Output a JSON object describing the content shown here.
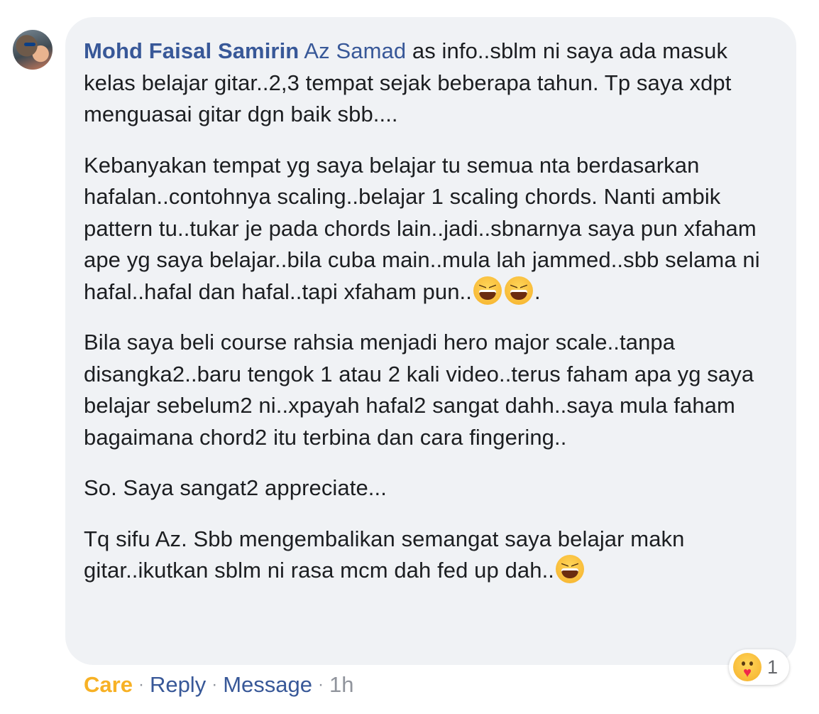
{
  "comment": {
    "author": "Mohd Faisal Samirin",
    "mention": "Az Samad",
    "first_line_rest": " as info..sblm ni saya ada masuk kelas belajar gitar..2,3 tempat sejak beberapa tahun. Tp saya xdpt menguasai gitar dgn baik sbb....",
    "paragraph_2": "Kebanyakan tempat yg saya belajar tu semua nta berdasarkan hafalan..contohnya scaling..belajar 1 scaling chords. Nanti ambik pattern tu..tukar je pada chords lain..jadi..sbnarnya saya pun xfaham ape yg saya belajar..bila cuba main..mula lah jammed..sbb selama ni hafal..hafal dan hafal..tapi xfaham pun..",
    "paragraph_2_end": ".",
    "paragraph_3": "Bila saya beli course rahsia menjadi hero major scale..tanpa disangka2..baru tengok 1 atau 2 kali video..terus faham apa yg saya belajar sebelum2 ni..xpayah hafal2 sangat dahh..saya mula faham bagaimana chord2 itu terbina dan cara fingering..",
    "paragraph_4": "So. Saya sangat2 appreciate...",
    "paragraph_5": "Tq sifu Az. Sbb mengembalikan semangat saya belajar makn gitar..ikutkan sblm ni rasa mcm dah fed up dah..",
    "emoji_name": "laughing-squinting-face-icon"
  },
  "reactions": {
    "icon": "care-reaction-icon",
    "count": "1"
  },
  "actions": {
    "care_label": "Care",
    "reply_label": "Reply",
    "message_label": "Message",
    "separator": "·",
    "time": "1h"
  },
  "colors": {
    "link_blue": "#385898",
    "care_yellow": "#f7b125",
    "bubble_bg": "#f0f2f5",
    "text": "#1c1e21",
    "meta_gray": "#90949c"
  }
}
